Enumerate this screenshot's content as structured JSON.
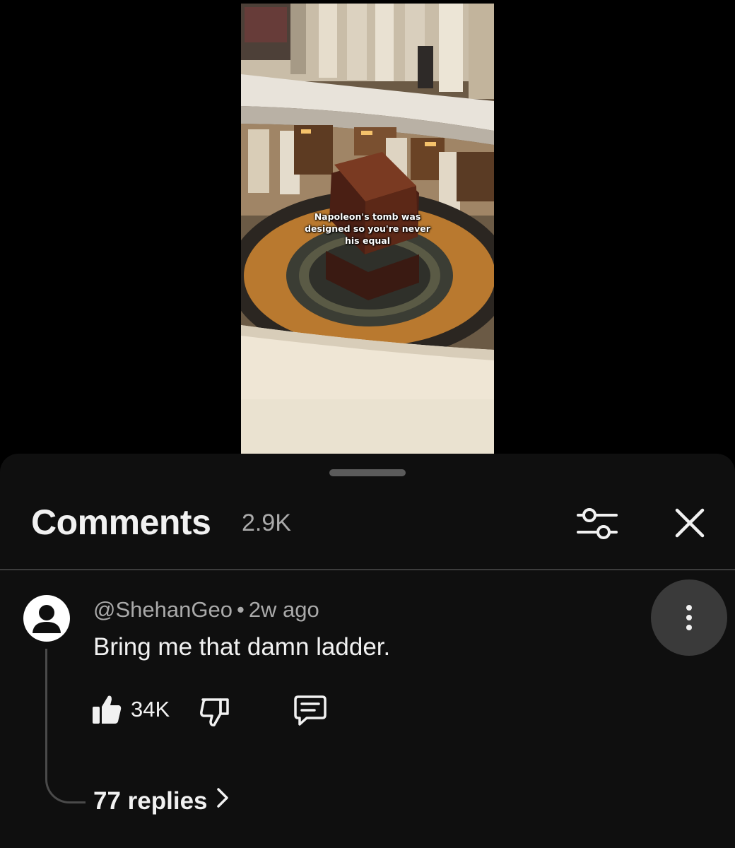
{
  "video": {
    "caption_lines": [
      "Napoleon's tomb was",
      "designed so you're never",
      "his equal"
    ]
  },
  "comments_panel": {
    "title": "Comments",
    "count": "2.9K",
    "filter_icon": "filter-sliders-icon",
    "close_icon": "close-icon"
  },
  "comment": {
    "author": "@ShehanGeo",
    "separator": "•",
    "time": "2w ago",
    "text": "Bring me that damn ladder.",
    "likes": "34K",
    "replies_label": "77 replies",
    "icons": {
      "avatar": "default-avatar-icon",
      "more": "more-vertical-icon",
      "like": "thumbs-up-icon",
      "dislike": "thumbs-down-icon",
      "reply": "reply-comment-icon",
      "expand": "chevron-right-icon"
    }
  },
  "colors": {
    "sheet_background": "#0f0f0f",
    "primary_text": "#f1f1f1",
    "secondary_text": "#aaaaaa",
    "more_button_bg": "#3a3a3a"
  }
}
